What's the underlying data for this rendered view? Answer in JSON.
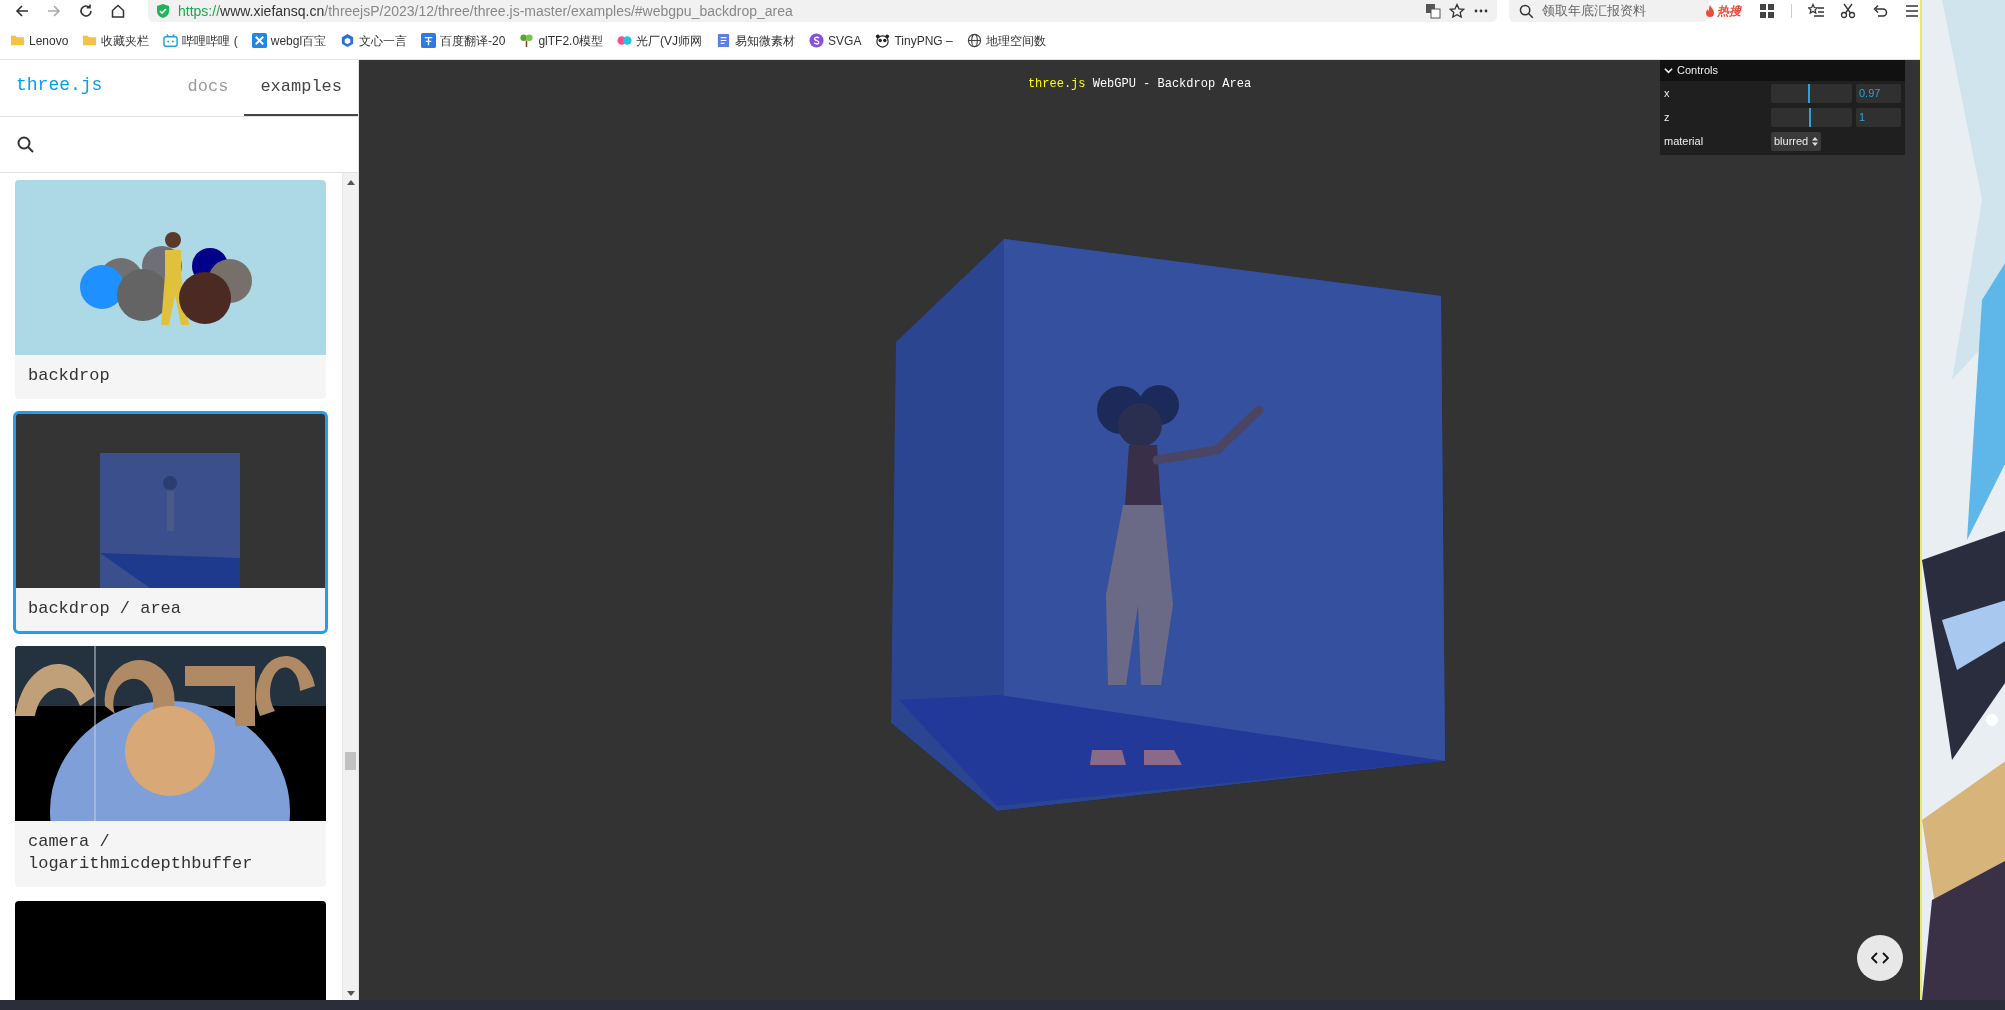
{
  "browser": {
    "url": {
      "scheme": "https://",
      "host": "www.xiefansq.cn",
      "path": "/threejsP/2023/12/three/three.js-master/examples/#webgpu_backdrop_area"
    },
    "search": {
      "placeholder": "领取年底汇报资料",
      "hot_badge": "热搜"
    },
    "bookmarks": [
      {
        "label": "Lenovo"
      },
      {
        "label": "收藏夹栏"
      },
      {
        "label": "哔哩哔哩 ("
      },
      {
        "label": "webgl百宝"
      },
      {
        "label": "文心一言"
      },
      {
        "label": "百度翻译-20"
      },
      {
        "label": "glTF2.0模型"
      },
      {
        "label": "光厂(VJ师网"
      },
      {
        "label": "易知微素材"
      },
      {
        "label": "SVGA"
      },
      {
        "label": "TinyPNG –"
      },
      {
        "label": "地理空间数"
      }
    ]
  },
  "sidebar": {
    "logo": "three.js",
    "tabs": [
      {
        "label": "docs",
        "selected": false
      },
      {
        "label": "examples",
        "selected": true
      }
    ],
    "examples": [
      {
        "title": "backdrop",
        "selected": false
      },
      {
        "title": "backdrop / area",
        "selected": true
      },
      {
        "title": "camera / logarithmicdepthbuffer",
        "selected": false
      },
      {
        "selected": false
      }
    ]
  },
  "viewport": {
    "title": {
      "link": "three.js",
      "text": "WebGPU - Backdrop Area"
    },
    "controls": {
      "title": "Controls",
      "expanded": true,
      "rows": [
        {
          "kind": "slider",
          "label": "x",
          "level": 0.46,
          "value": "0.97"
        },
        {
          "kind": "slider",
          "label": "z",
          "level": 0.47,
          "value": "1"
        },
        {
          "kind": "select",
          "label": "material",
          "value": "blurred"
        }
      ]
    }
  }
}
